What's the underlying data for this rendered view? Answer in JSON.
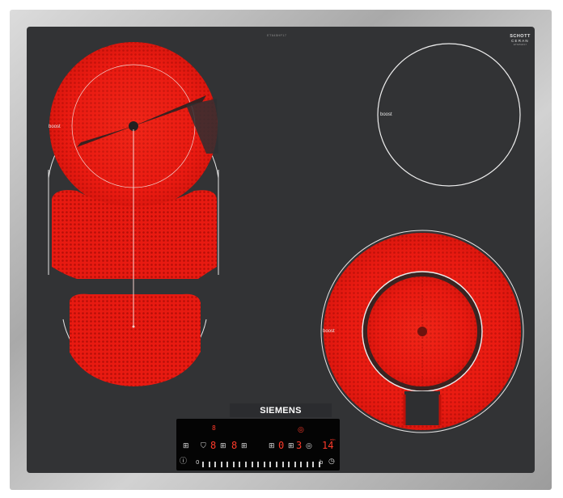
{
  "hob": {
    "model_text": "ET645HF17",
    "schott": {
      "line1": "SCHOTT",
      "line2": "CERAN",
      "line3": "ET645HF17"
    },
    "brand": "SIEMENS",
    "zones": {
      "left_top": {
        "label": "boost"
      },
      "right_top": {
        "label": "boost"
      },
      "right_bottom": {
        "label": "boost"
      }
    },
    "panel": {
      "displays": [
        "8",
        "8",
        "8",
        "0",
        "3",
        "14"
      ],
      "timer_label": "min",
      "scale_start": "0",
      "scale_end": "b"
    }
  },
  "colors": {
    "frame": "#b8b8b8",
    "glass": "#323335",
    "heat": "#ee1c13",
    "led": "#ff3a2a"
  }
}
